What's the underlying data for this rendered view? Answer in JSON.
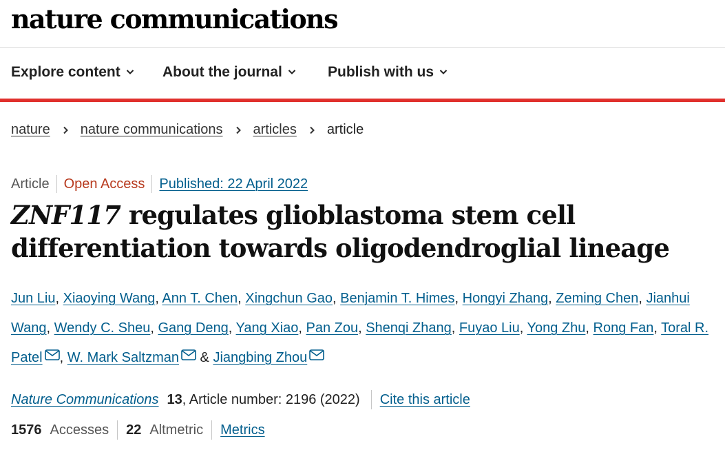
{
  "masthead": {
    "logo": "nature communications"
  },
  "nav": {
    "items": [
      {
        "label": "Explore content"
      },
      {
        "label": "About the journal"
      },
      {
        "label": "Publish with us"
      }
    ]
  },
  "breadcrumb": {
    "items": [
      "nature",
      "nature communications",
      "articles"
    ],
    "current": "article"
  },
  "article": {
    "type": "Article",
    "access": "Open Access",
    "published": "Published: 22 April 2022",
    "title_gene": "ZNF117",
    "title_rest": " regulates glioblastoma stem cell differentiation towards oligodendroglial lineage",
    "authors": [
      "Jun Liu",
      "Xiaoying Wang",
      "Ann T. Chen",
      "Xingchun Gao",
      "Benjamin T. Himes",
      "Hongyi Zhang",
      "Zeming Chen",
      "Jianhui Wang",
      "Wendy C. Sheu",
      "Gang Deng",
      "Yang Xiao",
      "Pan Zou",
      "Shenqi Zhang",
      "Fuyao Liu",
      "Yong Zhu",
      "Rong Fan",
      "Toral R. Patel",
      "W. Mark Saltzman",
      "Jiangbing Zhou"
    ],
    "author_separator": ", ",
    "author_conjunction": " & ",
    "citation": {
      "journal": "Nature Communications",
      "volume": "13",
      "article_number": ", Article number: 2196 (2022)",
      "cite_label": "Cite this article"
    },
    "metrics": {
      "accesses_value": "1576",
      "accesses_label": "Accesses",
      "altmetric_value": "22",
      "altmetric_label": "Altmetric",
      "metrics_link": "Metrics"
    }
  },
  "colors": {
    "link": "#025e8d",
    "accent_bar": "#e0302c",
    "open_access": "#b83b1f"
  },
  "icons": [
    "chevron-down-icon",
    "chevron-right-icon",
    "mail-icon"
  ]
}
